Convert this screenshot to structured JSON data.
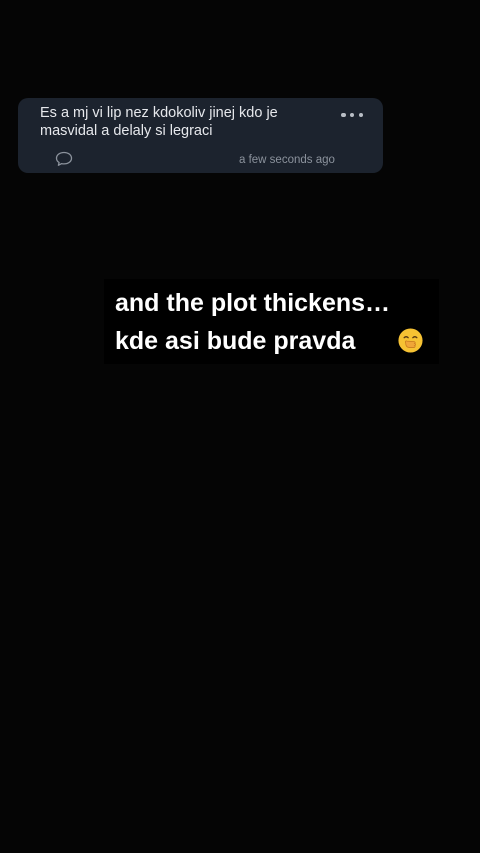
{
  "comment": {
    "text": "Es a mj vi lip nez kdokoliv jinej kdo je\nmasvidal a delaly si legraci",
    "timestamp": "a few seconds ago",
    "more_icon": "more-horizontal-icon",
    "reply_icon": "speech-bubble-icon"
  },
  "caption": {
    "line1": "and the plot thickens…",
    "line2": "kde asi bude pravda",
    "emoji_icon": "face-with-hand-over-mouth-icon"
  },
  "colors": {
    "background": "#050505",
    "card": "#1c232e",
    "caption_box": "#000000",
    "emoji_yellow": "#f6c233"
  }
}
